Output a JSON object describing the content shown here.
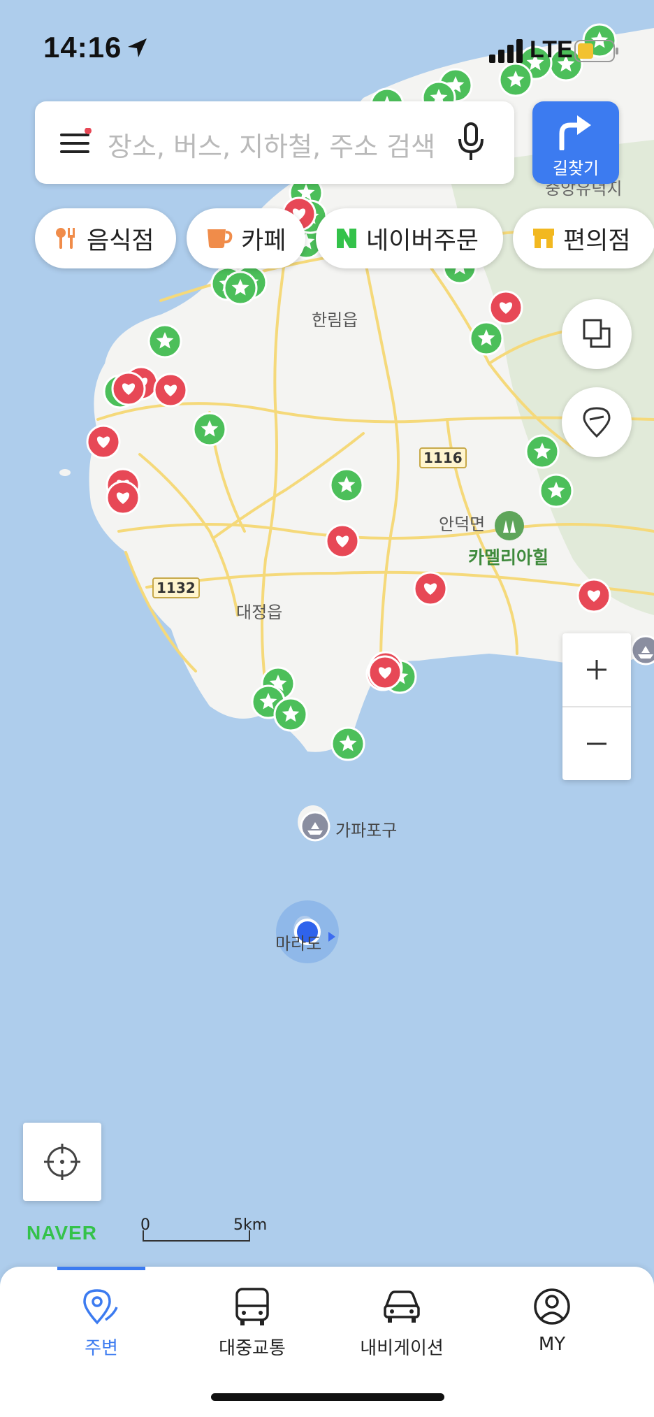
{
  "status_bar": {
    "time": "14:16",
    "network": "LTE",
    "icons": [
      "location-arrow-icon",
      "signal-icon",
      "battery-icon"
    ]
  },
  "search": {
    "placeholder": "장소, 버스, 지하철, 주소 검색",
    "menu_icon": "menu-icon",
    "mic_icon": "mic-icon"
  },
  "route_button": {
    "label": "길찾기",
    "icon": "turn-right-arrow-icon"
  },
  "categories": [
    {
      "label": "음식점",
      "icon": "fork-knife-icon",
      "color": "#f08c4a"
    },
    {
      "label": "카페",
      "icon": "cup-icon",
      "color": "#f08c4a"
    },
    {
      "label": "네이버주문",
      "icon": "naver-n-icon",
      "color": "#34c24a"
    },
    {
      "label": "편의점",
      "icon": "store-icon",
      "color": "#f2b820"
    }
  ],
  "map": {
    "labels": {
      "hallim": "한림읍",
      "andeok": "안덕면",
      "camellia": "카멜리아힐",
      "daejeong": "대정읍",
      "gapa_port": "가파포구",
      "marado": "마라도",
      "partial_top_right": "중앙유덕지"
    },
    "road_numbers": [
      "1116",
      "1132"
    ],
    "colors": {
      "sea": "#aecdec",
      "land": "#f4f4f2",
      "mountain": "#dfe8d8",
      "road": "#f5d97a",
      "favorite_marker": "#e74856",
      "star_marker": "#4cbf5a"
    }
  },
  "zoom": {
    "in": "+",
    "out": "−"
  },
  "branding": "NAVER",
  "scale": {
    "start": "0",
    "end": "5km"
  },
  "tabs": [
    {
      "label": "주변",
      "icon": "nearby-pin-icon",
      "active": true
    },
    {
      "label": "대중교통",
      "icon": "bus-icon",
      "active": false
    },
    {
      "label": "내비게이션",
      "icon": "car-icon",
      "active": false
    },
    {
      "label": "MY",
      "icon": "profile-icon",
      "active": false
    }
  ]
}
